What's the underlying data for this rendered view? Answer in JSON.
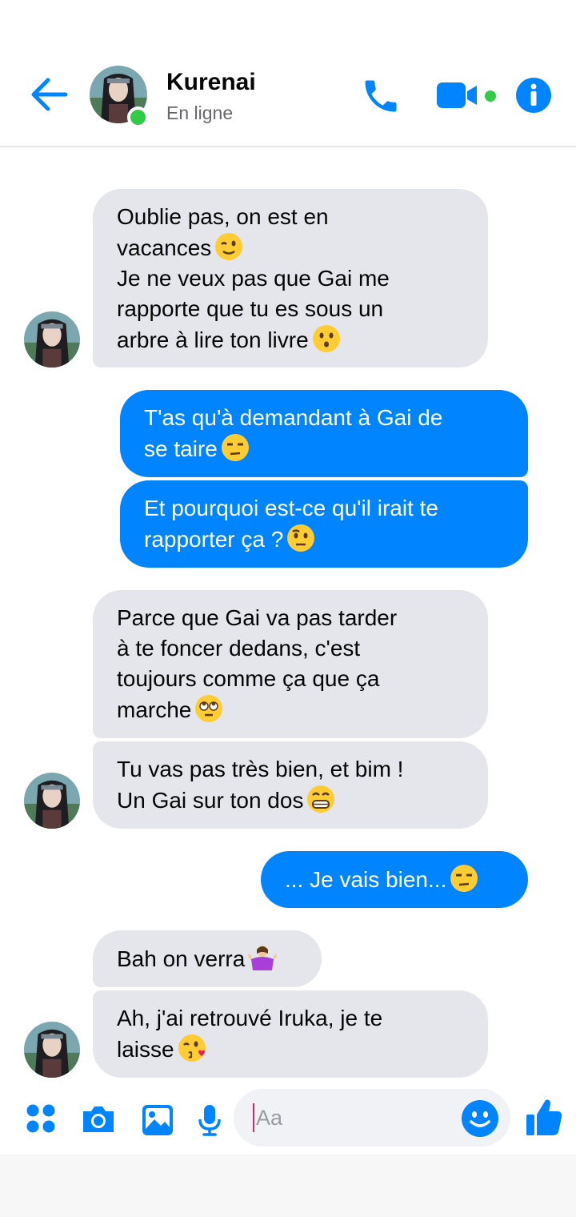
{
  "header": {
    "contact_name": "Kurenai",
    "status": "En ligne"
  },
  "messages": [
    {
      "direction": "in",
      "text": "Oublie pas, on est en\nvacances",
      "emoji": "wink"
    },
    {
      "direction": "in",
      "text": "Je ne veux pas que Gai me\nrapporte que tu es sous un\narbre à lire ton livre",
      "emoji": "kissing"
    },
    {
      "direction": "out",
      "text": "T'as qu'à demandant à Gai de\nse taire",
      "emoji": "unamused"
    },
    {
      "direction": "out",
      "text": "Et pourquoi est-ce qu'il irait te\nrapporter ça ?",
      "emoji": "raised-eyebrow"
    },
    {
      "direction": "in",
      "text": "Parce que Gai va pas tarder\nà te foncer dedans, c'est\ntoujours comme ça que ça\nmarche",
      "emoji": "eye-roll"
    },
    {
      "direction": "in",
      "text": "Tu vas pas très bien, et bim !\nUn Gai sur ton dos",
      "emoji": "grin"
    },
    {
      "direction": "out",
      "text": "... Je vais bien...",
      "emoji": "unamused"
    },
    {
      "direction": "in",
      "text": "Bah on verra",
      "emoji": "shrug"
    },
    {
      "direction": "in",
      "text": "Ah, j'ai retrouvé Iruka, je te\nlaisse",
      "emoji": "kiss"
    }
  ],
  "composer": {
    "placeholder": "Aa"
  },
  "colors": {
    "accent": "#0084ff",
    "incoming_bubble": "#e4e6eb",
    "online": "#31cc46"
  },
  "icons": [
    "back-arrow-icon",
    "phone-icon",
    "video-camera-icon",
    "info-icon",
    "apps-grid-icon",
    "camera-icon",
    "image-icon",
    "microphone-icon",
    "smiley-icon",
    "thumbs-up-icon"
  ]
}
